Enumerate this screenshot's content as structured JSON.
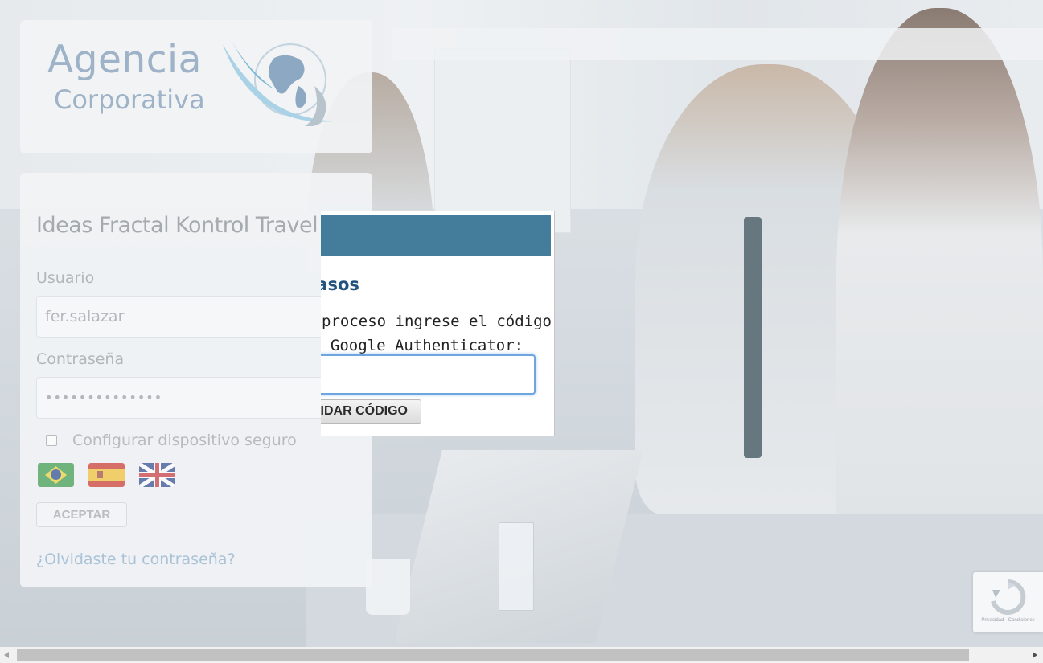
{
  "logo": {
    "line1": "Agencia",
    "line2": "Corporativa"
  },
  "login": {
    "title": "Ideas Fractal Kontrol Travel",
    "user_label": "Usuario",
    "user_value": "fer.salazar",
    "password_label": "Contraseña",
    "password_value": "••••••••••••••",
    "remember_label": "Configurar dispositivo seguro",
    "languages": [
      "brazil-flag-icon",
      "spain-flag-icon",
      "uk-flag-icon"
    ],
    "accept_label": "ACEPTAR",
    "forgot_link": "¿Olvidaste tu contraseña?"
  },
  "modal": {
    "title": "dos pasos",
    "text_line1": "proceso ingrese el código",
    "text_line2": "n Google Authenticator:",
    "code_value": "",
    "validate_label": "IDAR CÓDIGO"
  },
  "recaptcha": {
    "footer": "Privacidad - Condiciones"
  },
  "colors": {
    "modal_header": "#447d9c",
    "modal_title": "#22527e",
    "input_focus": "#6fa5df"
  }
}
